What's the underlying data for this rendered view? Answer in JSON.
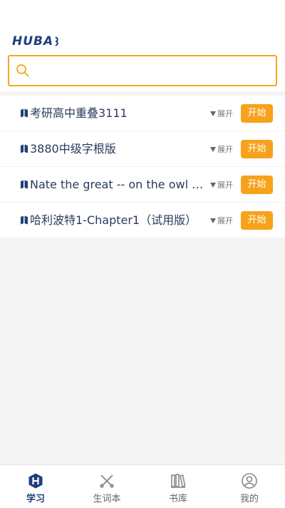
{
  "header": {
    "logo_text": "HUBA",
    "search": {
      "placeholder": "",
      "value": ""
    }
  },
  "books": [
    {
      "title": "考研高中重叠3111",
      "expand_label": "展开",
      "start_label": "开始"
    },
    {
      "title": "3880中级字根版",
      "expand_label": "展开",
      "start_label": "开始"
    },
    {
      "title": "Nate the great -- on the owl express",
      "expand_label": "展开",
      "start_label": "开始"
    },
    {
      "title": "哈利波特1-Chapter1（试用版）",
      "expand_label": "展开",
      "start_label": "开始"
    }
  ],
  "tabbar": {
    "items": [
      {
        "label": "学习",
        "icon": "study-icon",
        "active": true
      },
      {
        "label": "生词本",
        "icon": "vocabulary-icon",
        "active": false
      },
      {
        "label": "书库",
        "icon": "library-icon",
        "active": false
      },
      {
        "label": "我的",
        "icon": "profile-icon",
        "active": false
      }
    ]
  },
  "colors": {
    "accent": "#f7a21b",
    "brand": "#1f3f7a",
    "search_border": "#f5a623"
  }
}
